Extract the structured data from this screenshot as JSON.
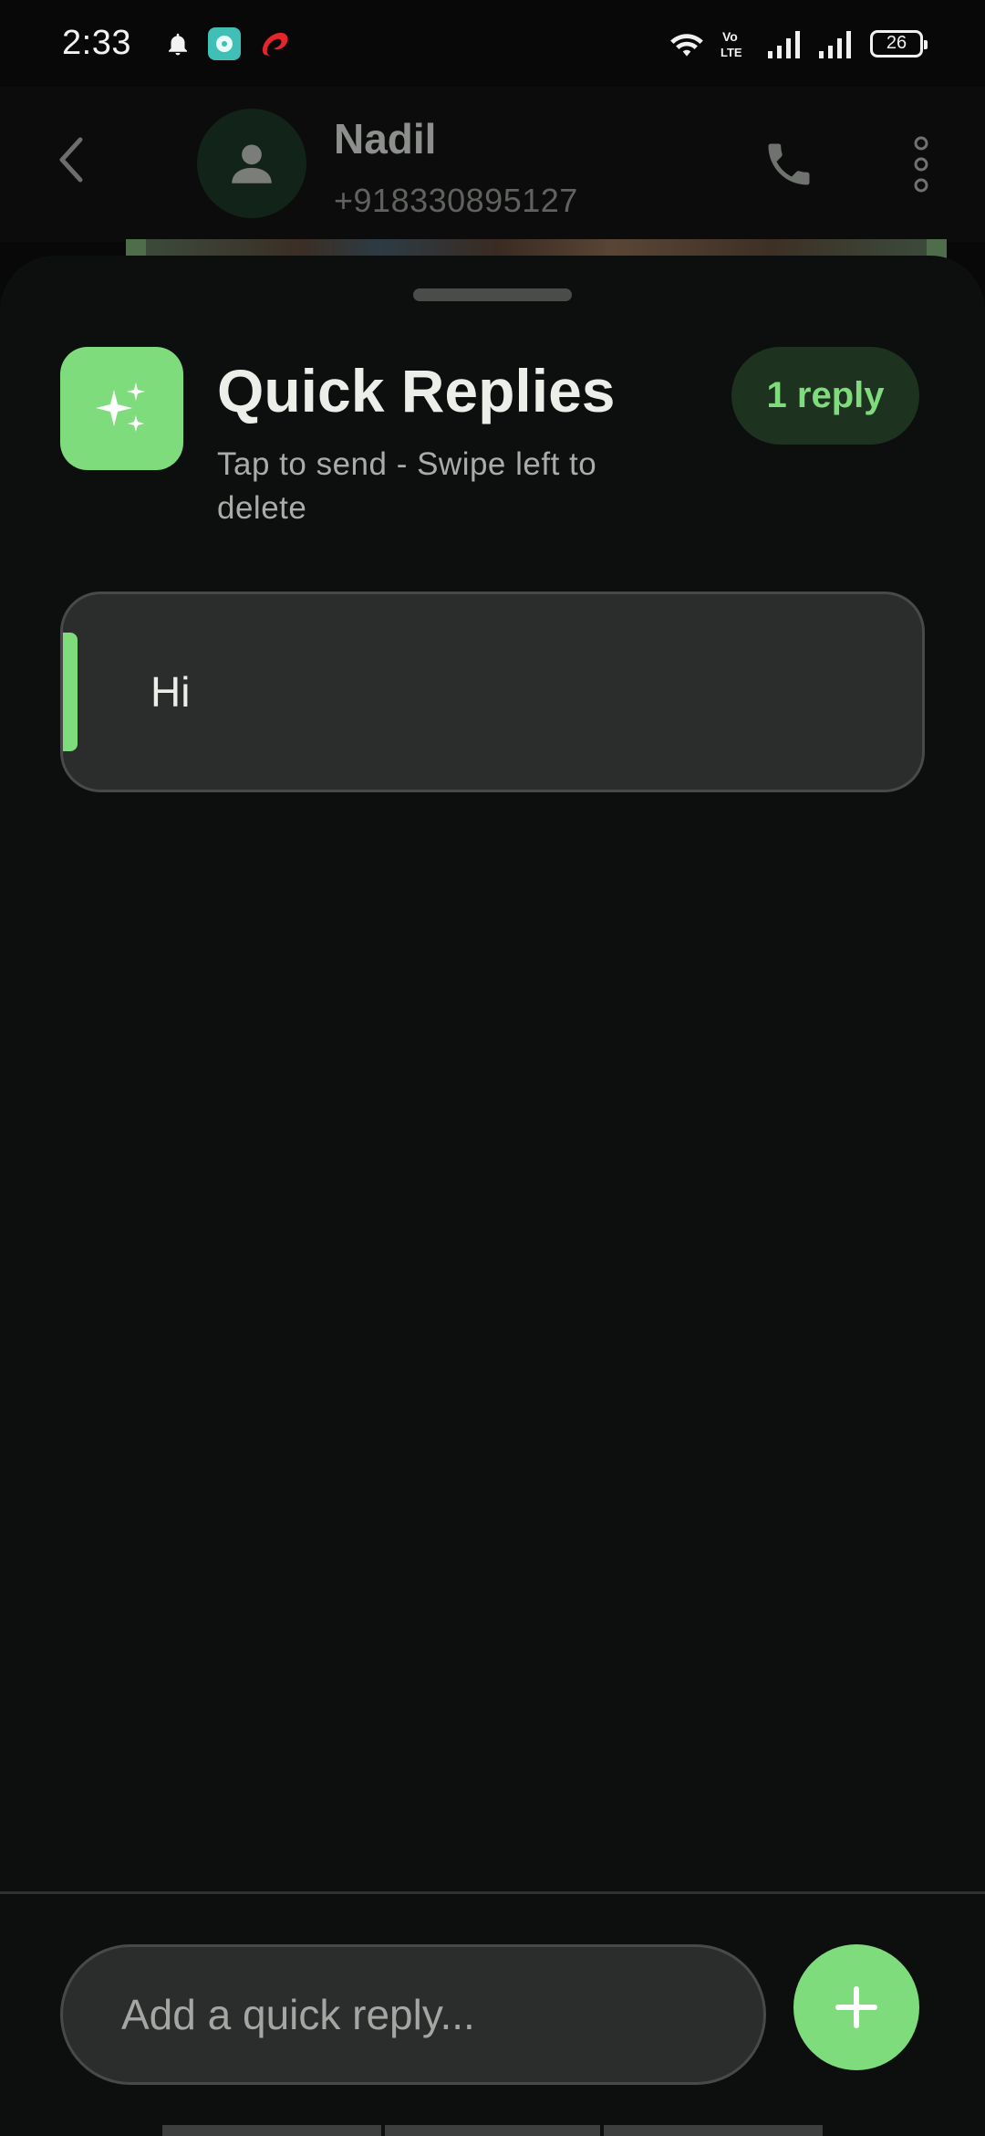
{
  "status_bar": {
    "time": "2:33",
    "battery": "26",
    "left_icons": [
      "bell-icon",
      "app-notification-icon",
      "airtel-icon"
    ],
    "right_icons": [
      "wifi-icon",
      "volte-icon",
      "signal-icon",
      "signal-icon"
    ]
  },
  "app_bar": {
    "contact_name": "Nadil",
    "contact_number": "+918330895127"
  },
  "sheet": {
    "title": "Quick Replies",
    "subtitle": "Tap to send - Swipe left to delete",
    "count_label": "1 reply",
    "replies": [
      {
        "text": "Hi"
      }
    ],
    "input_placeholder": "Add a quick reply..."
  },
  "colors": {
    "accent": "#7fdc7c",
    "sheet_background": "#0d0f0e",
    "card_background": "#2b2d2c"
  }
}
